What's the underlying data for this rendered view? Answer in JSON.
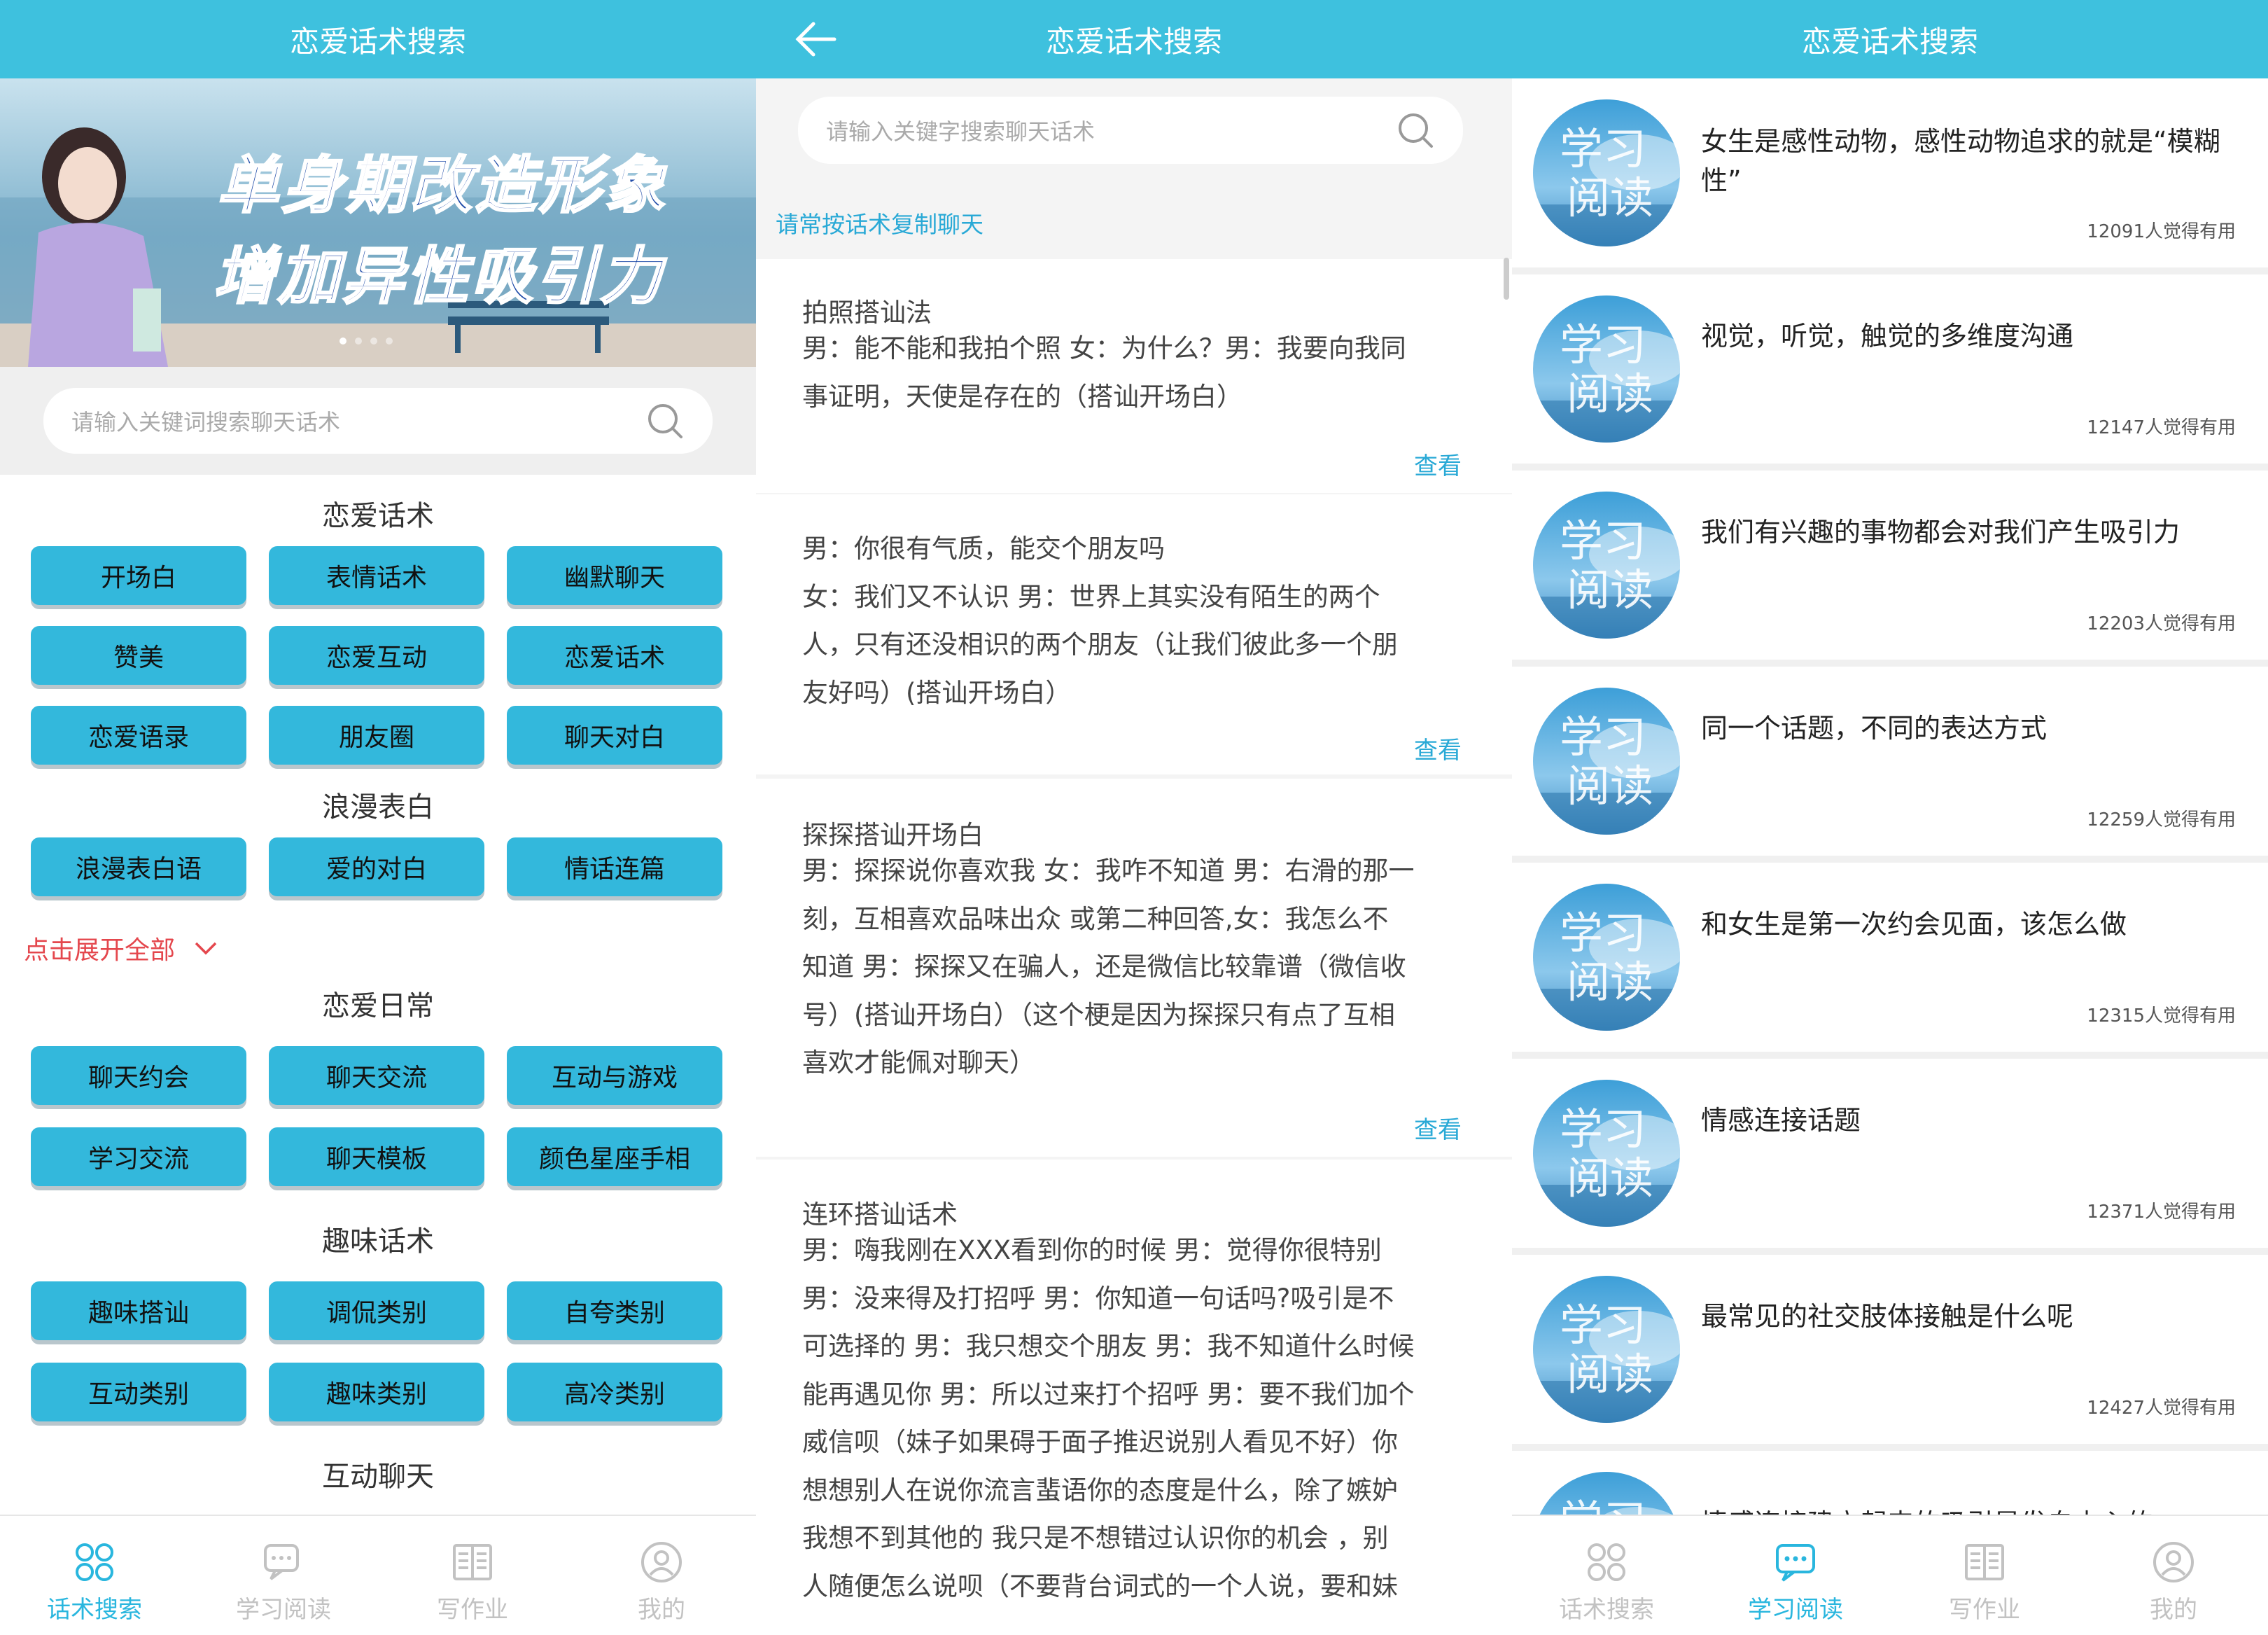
{
  "app_title": "恋爱话术搜索",
  "tabs": [
    "话术搜索",
    "学习阅读",
    "写作业",
    "我的"
  ],
  "screen1": {
    "banner": {
      "line1": "单身期改造形象",
      "line2": "增加异性吸引力"
    },
    "search_placeholder": "请输入关键词搜索聊天话术",
    "sections": [
      {
        "title": "恋爱话术",
        "items": [
          "开场白",
          "表情话术",
          "幽默聊天",
          "赞美",
          "恋爱互动",
          "恋爱话术",
          "恋爱语录",
          "朋友圈",
          "聊天对白"
        ]
      },
      {
        "title": "浪漫表白",
        "items": [
          "浪漫表白语",
          "爱的对白",
          "情话连篇"
        ]
      },
      {
        "title": "恋爱日常",
        "items": [
          "聊天约会",
          "聊天交流",
          "互动与游戏",
          "学习交流",
          "聊天模板",
          "颜色星座手相"
        ]
      },
      {
        "title": "趣味话术",
        "items": [
          "趣味搭讪",
          "调侃类别",
          "自夸类别",
          "互动类别",
          "趣味类别",
          "高冷类别"
        ]
      },
      {
        "title": "互动聊天",
        "items": []
      }
    ],
    "expand_label": "点击展开全部"
  },
  "screen2": {
    "search_placeholder": "请输入关键字搜索聊天话术",
    "tip": "请常按话术复制聊天",
    "view_label": "查看",
    "cards": [
      {
        "title": "拍照搭讪法",
        "lines": [
          "男：能不能和我拍个照 女：为什么？男：我要向我同",
          "事证明，天使是存在的（搭讪开场白）"
        ]
      },
      {
        "title": "",
        "lines": [
          "男：你很有气质，能交个朋友吗",
          "女：我们又不认识 男：世界上其实没有陌生的两个",
          "人，只有还没相识的两个朋友（让我们彼此多一个朋",
          "友好吗）(搭讪开场白）"
        ]
      },
      {
        "title": "探探搭讪开场白",
        "lines": [
          "男：探探说你喜欢我 女：我咋不知道 男：右滑的那一",
          "刻，互相喜欢品味出众 或第二种回答,女：我怎么不",
          "知道 男：探探又在骗人，还是微信比较靠谱（微信收",
          "号）(搭讪开场白）（这个梗是因为探探只有点了互相",
          "喜欢才能佩对聊天）"
        ]
      },
      {
        "title": "连环搭讪话术",
        "lines": [
          "男：嗨我刚在XXX看到你的时候 男：觉得你很特别",
          "男：没来得及打招呼 男：你知道一句话吗?吸引是不",
          "可选择的 男：我只想交个朋友 男：我不知道什么时候",
          "能再遇见你 男：所以过来打个招呼 男：要不我们加个",
          "威信呗（妹子如果碍于面子推迟说别人看见不好）你",
          "想想别人在说你流言蜚语你的态度是什么，除了嫉妒",
          "我想不到其他的 我只是不想错过认识你的机会 ，别",
          "人随便怎么说呗（不要背台词式的一个人说，要和妹"
        ]
      }
    ]
  },
  "screen3": {
    "thumb_text": [
      "学习",
      "阅读"
    ],
    "articles": [
      {
        "title": "女生是感性动物，感性动物追求的就是“模糊性”",
        "count": "12091人觉得有用"
      },
      {
        "title": "视觉，听觉，触觉的多维度沟通",
        "count": "12147人觉得有用"
      },
      {
        "title": "我们有兴趣的事物都会对我们产生吸引力",
        "count": "12203人觉得有用"
      },
      {
        "title": "同一个话题，不同的表达方式",
        "count": "12259人觉得有用"
      },
      {
        "title": "和女生是第一次约会见面，该怎么做",
        "count": "12315人觉得有用"
      },
      {
        "title": "情感连接话题",
        "count": "12371人觉得有用"
      },
      {
        "title": "最常见的社交肢体接触是什么呢",
        "count": "12427人觉得有用"
      },
      {
        "title": "情感连接建立起来的吸引是发自内心的",
        "count": ""
      }
    ]
  }
}
